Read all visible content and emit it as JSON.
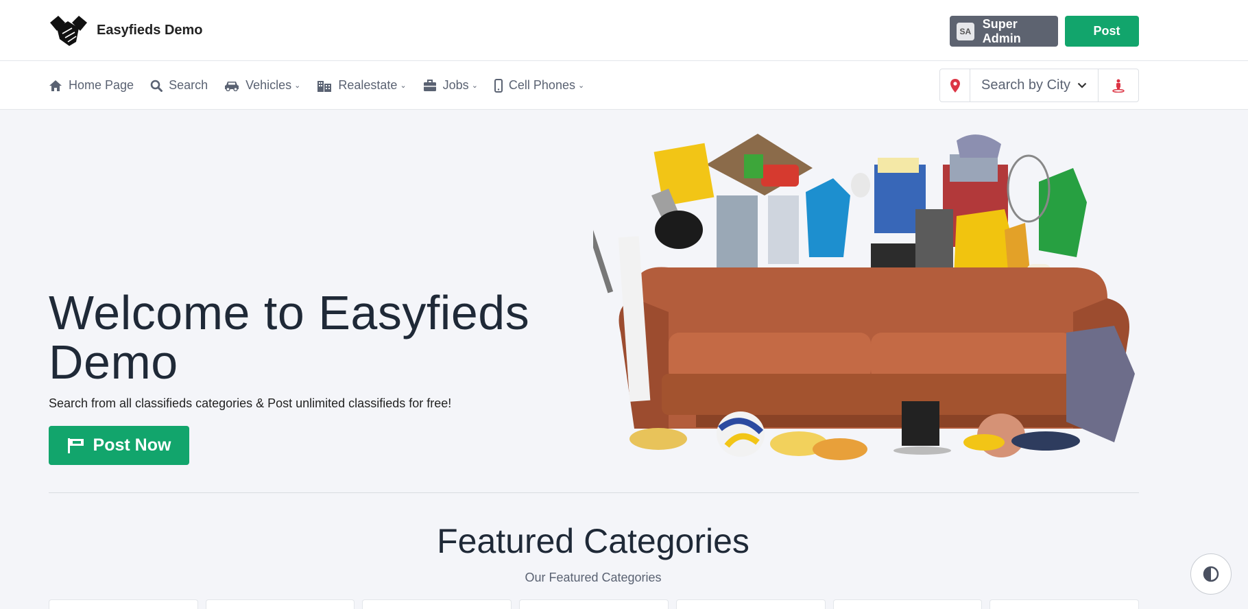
{
  "header": {
    "brand_name": "Easyfieds Demo",
    "brand_logo": "handshake-icon",
    "admin_initials": "SA",
    "admin_label": "Super Admin",
    "post_label": "Post"
  },
  "nav": {
    "items": [
      {
        "label": "Home Page",
        "icon": "home-icon",
        "dropdown": false
      },
      {
        "label": "Search",
        "icon": "search-icon",
        "dropdown": false
      },
      {
        "label": "Vehicles",
        "icon": "car-icon",
        "dropdown": true
      },
      {
        "label": "Realestate",
        "icon": "building-icon",
        "dropdown": true
      },
      {
        "label": "Jobs",
        "icon": "briefcase-icon",
        "dropdown": true
      },
      {
        "label": "Cell Phones",
        "icon": "mobile-icon",
        "dropdown": true
      }
    ],
    "city_select": "Search by City"
  },
  "hero": {
    "title": "Welcome to Easyfieds Demo",
    "subtitle": "Search from all classifieds categories & Post unlimited classifieds for free!",
    "cta_label": "Post Now"
  },
  "featured": {
    "title": "Featured Categories",
    "subtitle": "Our Featured Categories"
  },
  "colors": {
    "primary": "#12a56c",
    "admin": "#5d6370",
    "background": "#f4f5f9",
    "pin": "#dc3545"
  }
}
